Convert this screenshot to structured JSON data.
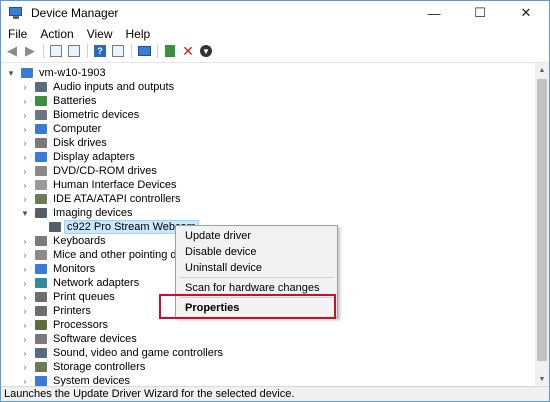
{
  "window": {
    "title": "Device Manager",
    "controls": {
      "minimize": "—",
      "maximize": "☐",
      "close": "✕"
    }
  },
  "menu": [
    "File",
    "Action",
    "View",
    "Help"
  ],
  "toolbar": {
    "icons": [
      "back-icon",
      "forward-icon",
      "properties-grid-icon",
      "update-list-icon",
      "help-icon",
      "show-hidden-icon",
      "monitor-icon",
      "update-driver-icon",
      "uninstall-icon",
      "enable-download-icon"
    ]
  },
  "tree": {
    "root": "vm-w10-1903",
    "categories": [
      {
        "label": "Audio inputs and outputs",
        "color": "#5a6b7d",
        "expanded": false
      },
      {
        "label": "Batteries",
        "color": "#3b8f3b",
        "expanded": false
      },
      {
        "label": "Biometric devices",
        "color": "#6a7580",
        "expanded": false
      },
      {
        "label": "Computer",
        "color": "#3a7bd5",
        "expanded": false
      },
      {
        "label": "Disk drives",
        "color": "#7a7a7a",
        "expanded": false
      },
      {
        "label": "Display adapters",
        "color": "#3a7bd5",
        "expanded": false
      },
      {
        "label": "DVD/CD-ROM drives",
        "color": "#8a8a8a",
        "expanded": false
      },
      {
        "label": "Human Interface Devices",
        "color": "#9a9a9a",
        "expanded": false
      },
      {
        "label": "IDE ATA/ATAPI controllers",
        "color": "#6b7c52",
        "expanded": false
      },
      {
        "label": "Imaging devices",
        "color": "#555f6a",
        "expanded": true
      },
      {
        "label": "Keyboards",
        "color": "#7a7a7a",
        "expanded": false
      },
      {
        "label": "Mice and other pointing devices",
        "color": "#8a8a8a",
        "expanded": false
      },
      {
        "label": "Monitors",
        "color": "#3a7bd5",
        "expanded": false
      },
      {
        "label": "Network adapters",
        "color": "#2e8b9a",
        "expanded": false
      },
      {
        "label": "Print queues",
        "color": "#6d6d6d",
        "expanded": false
      },
      {
        "label": "Printers",
        "color": "#6d6d6d",
        "expanded": false
      },
      {
        "label": "Processors",
        "color": "#5b6b3a",
        "expanded": false
      },
      {
        "label": "Software devices",
        "color": "#7a7a7a",
        "expanded": false
      },
      {
        "label": "Sound, video and game controllers",
        "color": "#5a6b7d",
        "expanded": false
      },
      {
        "label": "Storage controllers",
        "color": "#6b7c52",
        "expanded": false
      },
      {
        "label": "System devices",
        "color": "#3a7bd5",
        "expanded": false
      }
    ],
    "child_of_imaging": "c922 Pro Stream Webcam"
  },
  "context_menu": {
    "items": [
      "Update driver",
      "Disable device",
      "Uninstall device",
      "Scan for hardware changes",
      "Properties"
    ]
  },
  "status": "Launches the Update Driver Wizard for the selected device.",
  "colors": {
    "selection": "#cce8ff",
    "highlight_border": "#c8102e",
    "accent": "#3a7bd5"
  }
}
